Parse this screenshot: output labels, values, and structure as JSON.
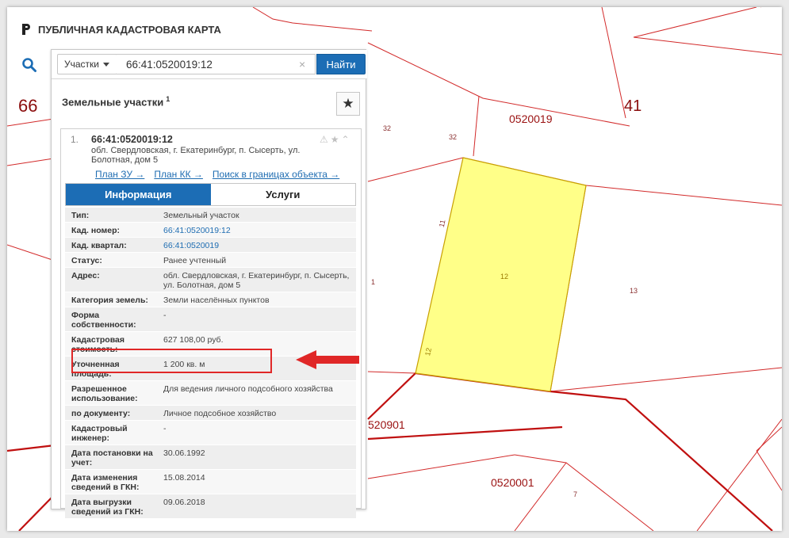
{
  "app": {
    "title": "ПУБЛИЧНАЯ КАДАСТРОВАЯ КАРТА"
  },
  "search": {
    "type_selected": "Участки",
    "value": "66:41:0520019:12",
    "clear_symbol": "×",
    "find_label": "Найти"
  },
  "panel": {
    "heading": "Земельные участки",
    "count": "1",
    "favorite_symbol": "★"
  },
  "result": {
    "number": "1.",
    "cad_number": "66:41:0520019:12",
    "address": "обл. Свердловская, г. Екатеринбург, п. Сысерть, ул. Болотная, дом 5",
    "links": [
      "План ЗУ →",
      "План КК →",
      "Поиск в границах объекта →"
    ],
    "status_icons": [
      "⚠",
      "★",
      "⌃"
    ]
  },
  "tabs": [
    {
      "label": "Информация",
      "active": true
    },
    {
      "label": "Услуги",
      "active": false
    }
  ],
  "info_rows": [
    {
      "key": "Тип:",
      "value": "Земельный участок"
    },
    {
      "key": "Кад. номер:",
      "value": "66:41:0520019:12",
      "link": true
    },
    {
      "key": "Кад. квартал:",
      "value": "66:41:0520019",
      "link": true
    },
    {
      "key": "Статус:",
      "value": "Ранее учтенный"
    },
    {
      "key": "Адрес:",
      "value": "обл. Свердловская, г. Екатеринбург, п. Сысерть, ул. Болотная, дом 5"
    },
    {
      "key": "Категория земель:",
      "value": "Земли населённых пунктов"
    },
    {
      "key": "Форма собственности:",
      "value": "-"
    },
    {
      "key": "Кадастровая стоимость:",
      "value": "627 108,00 руб."
    },
    {
      "key": "Уточненная площадь:",
      "value": "1 200 кв. м"
    },
    {
      "key": "Разрешенное использование:",
      "value": "Для ведения личного подсобного хозяйства"
    },
    {
      "key": "по документу:",
      "value": "Личное подсобное хозяйство"
    },
    {
      "key": "Кадастровый инженер:",
      "value": "-"
    },
    {
      "key": "Дата постановки на учет:",
      "value": "30.06.1992"
    },
    {
      "key": "Дата изменения сведений в ГКН:",
      "value": "15.08.2014"
    },
    {
      "key": "Дата выгрузки сведений из ГКН:",
      "value": "09.06.2018"
    }
  ],
  "map_labels": {
    "district_66": "66",
    "district_41": "41",
    "quarter_0520019": "0520019",
    "quarter_0520901": "520901",
    "quarter_0520001": "0520001",
    "parcel_32a": "32",
    "parcel_32b": "32",
    "parcel_11": "11",
    "parcel_1": "1",
    "parcel_12": "12",
    "parcel_12b": "12",
    "parcel_13": "13",
    "parcel_7": "7"
  },
  "colors": {
    "accent": "#1c6db5",
    "boundary": "#d22020",
    "parcel_fill": "#ffff88",
    "highlight": "#e02727"
  }
}
